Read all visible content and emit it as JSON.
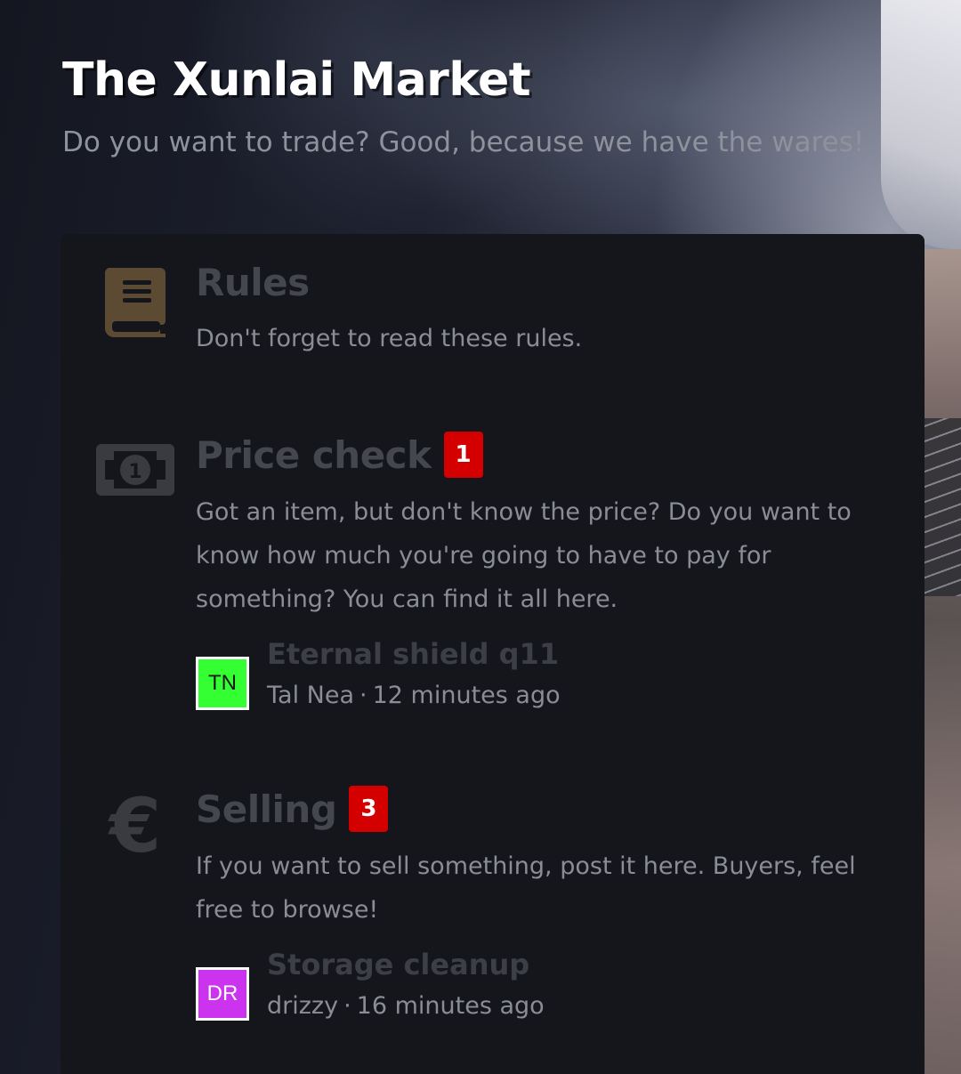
{
  "header": {
    "title": "The Xunlai Market",
    "subtitle": "Do you want to trade? Good, because we have the wares!"
  },
  "forums": [
    {
      "icon": "book-icon",
      "icon_color": "#5c4a33",
      "title": "Rules",
      "badge": "",
      "description": "Don't forget to read these rules."
    },
    {
      "icon": "money-bill-icon",
      "icon_color": "#3a3b40",
      "title": "Price check",
      "badge": "1",
      "description": "Got an item, but don't know the price? Do you want to know how much you're going to have to pay for something? You can find it all here.",
      "latest": {
        "avatar_initials": "TN",
        "avatar_color": "#33ff33",
        "topic": "Eternal shield q11",
        "author": "Tal Nea",
        "separator": "·",
        "time": "12 minutes ago"
      }
    },
    {
      "icon": "euro-icon",
      "icon_color": "#3a3b40",
      "title": "Selling",
      "badge": "3",
      "description": "If you want to sell something, post it here. Buyers, feel free to browse!",
      "latest": {
        "avatar_initials": "DR",
        "avatar_color": "#cc33ee",
        "topic": "Storage cleanup",
        "author": "drizzy",
        "separator": "·",
        "time": "16 minutes ago"
      }
    }
  ]
}
